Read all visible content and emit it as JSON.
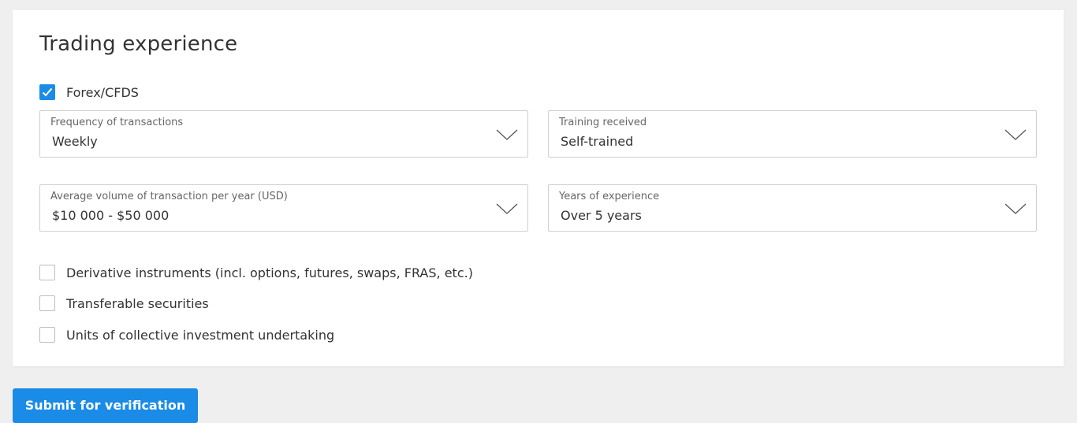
{
  "section": {
    "title": "Trading experience"
  },
  "forex": {
    "label": "Forex/CFDS",
    "checked": true
  },
  "selects": {
    "frequency": {
      "label": "Frequency of transactions",
      "value": "Weekly"
    },
    "training": {
      "label": "Training received",
      "value": "Self-trained"
    },
    "volume": {
      "label": "Average volume of transaction per year (USD)",
      "value": "$10 000 - $50 000"
    },
    "years": {
      "label": "Years of experience",
      "value": "Over 5 years"
    }
  },
  "other_checks": [
    {
      "label": "Derivative instruments (incl. options, futures, swaps, FRAS, etc.)",
      "checked": false
    },
    {
      "label": "Transferable securities",
      "checked": false
    },
    {
      "label": "Units of collective investment undertaking",
      "checked": false
    }
  ],
  "submit_label": "Submit for verification",
  "colors": {
    "accent": "#1a8ce8",
    "background": "#efefef",
    "card": "#ffffff"
  },
  "icons": {
    "checked": "checkmark-icon",
    "dropdown": "chevron-down-icon"
  }
}
